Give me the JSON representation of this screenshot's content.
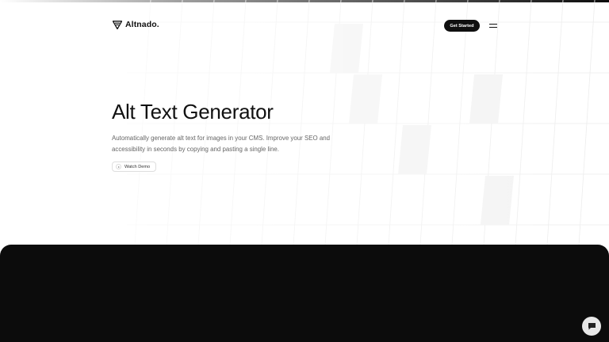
{
  "header": {
    "brand": "Altnado.",
    "logo_icon": "altnado-logo-icon",
    "cta_label": "Get Started",
    "menu_icon": "hamburger-menu-icon"
  },
  "hero": {
    "title": "Alt Text Generator",
    "description": "Automatically generate alt text for images in your CMS. Improve your SEO and accessibility in seconds by copying and pasting a single line.",
    "demo_label": "Watch Demo",
    "demo_icon": "play-icon"
  },
  "chat": {
    "icon": "chat-bubble-icon"
  },
  "colors": {
    "primary": "#0f0f0f",
    "background": "#ffffff",
    "muted_text": "#666666",
    "grid_line": "#f0f0f0"
  }
}
